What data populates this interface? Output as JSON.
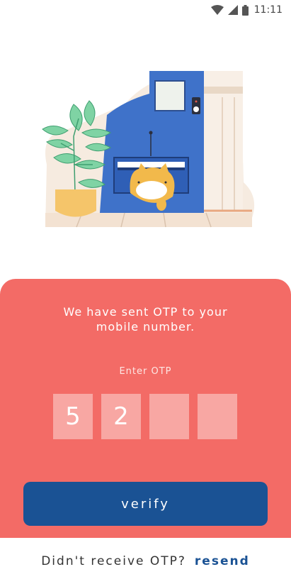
{
  "status_bar": {
    "time": "11:11"
  },
  "card": {
    "message": "We have sent OTP to your\nmobile number.",
    "otp_label": "Enter OTP",
    "otp_digits": [
      "5",
      "2",
      "",
      ""
    ],
    "verify_label": "verify"
  },
  "footer": {
    "prompt": "Didn't receive OTP?",
    "resend_label": "resend"
  },
  "colors": {
    "card_bg": "#f36b66",
    "otp_box": "#f8a7a3",
    "button_bg": "#1a5294",
    "link": "#1a5294"
  },
  "icons": [
    "wifi-icon",
    "signal-icon",
    "battery-icon"
  ]
}
